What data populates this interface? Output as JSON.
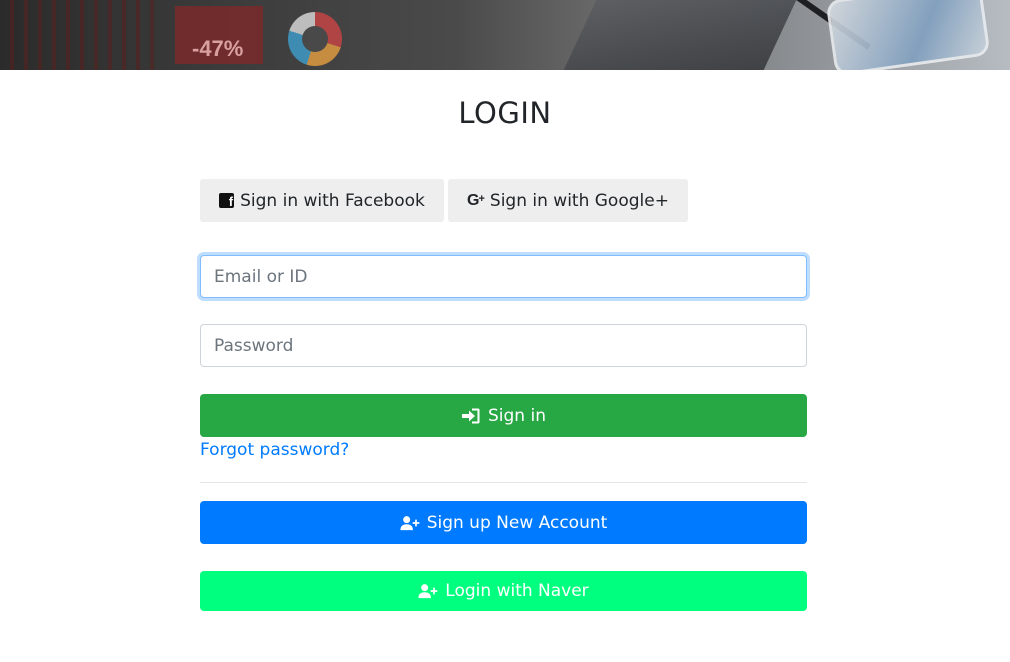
{
  "header": {
    "banner_text": "-47%"
  },
  "login": {
    "title": "LOGIN",
    "facebook_label": "Sign in with Facebook",
    "google_label": "Sign in with Google+",
    "email_placeholder": "Email or ID",
    "email_value": "",
    "password_placeholder": "Password",
    "password_value": "",
    "signin_label": "Sign in",
    "forgot_label": "Forgot password?",
    "signup_label": "Sign up New Account",
    "naver_label": "Login with Naver"
  },
  "icons": {
    "facebook": "facebook-icon",
    "google_plus": "google-plus-icon",
    "sign_in": "sign-in-icon",
    "user_plus": "user-plus-icon"
  },
  "colors": {
    "signin": "#28a745",
    "signup": "#007bff",
    "naver": "#00ff7f",
    "link": "#007bff",
    "social_bg": "#eeeeee",
    "focus_border": "#80bdff"
  }
}
